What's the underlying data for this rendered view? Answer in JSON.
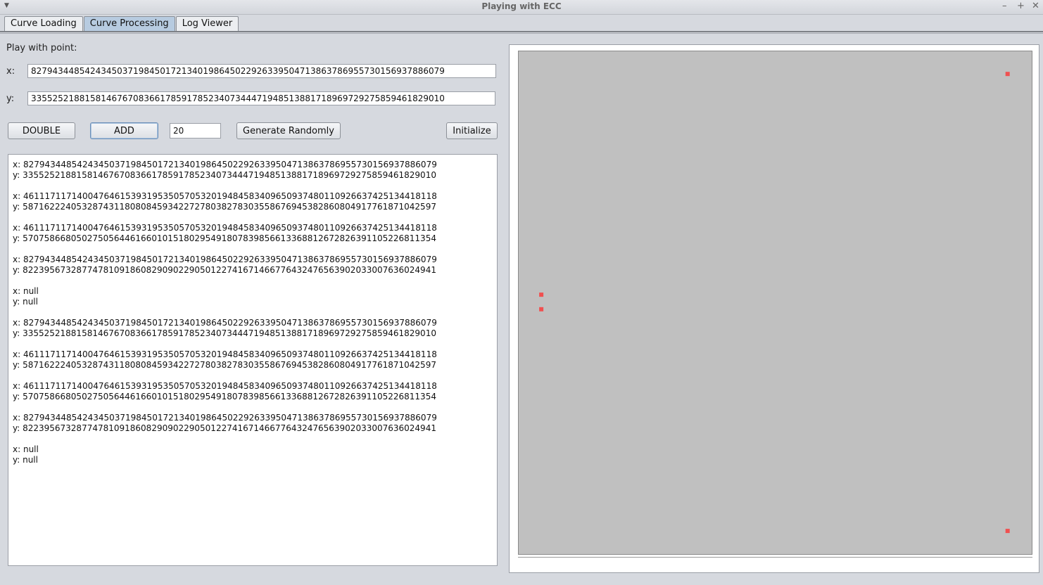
{
  "window": {
    "title": "Playing with ECC",
    "controls": [
      "–",
      "+",
      "✕"
    ]
  },
  "tabs": [
    {
      "label": "Curve Loading",
      "active": false
    },
    {
      "label": "Curve Processing",
      "active": true
    },
    {
      "label": "Log Viewer",
      "active": false
    }
  ],
  "point_panel": {
    "heading": "Play with point:",
    "x_label": "x:",
    "x_value": "82794344854243450371984501721340198645022926339504713863786955730156937886079",
    "y_label": "y:",
    "y_value": "33552521881581467670836617859178523407344471948513881718969729275859461829010"
  },
  "buttons": {
    "double": "DOUBLE",
    "add": "ADD",
    "count_value": "20",
    "generate": "Generate Randomly",
    "initialize": "Initialize"
  },
  "output_points": [
    {
      "x": "x: 82794344854243450371984501721340198645022926339504713863786955730156937886079",
      "y": "y: 33552521881581467670836617859178523407344471948513881718969729275859461829010"
    },
    {
      "x": "x: 46111711714004764615393195350570532019484583409650937480110926637425134418118",
      "y": "y: 58716222405328743118080845934227278038278303558676945382860804917761871042597"
    },
    {
      "x": "x: 46111711714004764615393195350570532019484583409650937480110926637425134418118",
      "y": "y: 57075866805027505644616601015180295491807839856613368812672826391105226811354"
    },
    {
      "x": "x: 82794344854243450371984501721340198645022926339504713863786955730156937886079",
      "y": "y: 82239567328774781091860829090229050122741671466776432476563902033007636024941"
    },
    {
      "x": "x: null",
      "y": "y: null"
    },
    {
      "x": "x: 82794344854243450371984501721340198645022926339504713863786955730156937886079",
      "y": "y: 33552521881581467670836617859178523407344471948513881718969729275859461829010"
    },
    {
      "x": "x: 46111711714004764615393195350570532019484583409650937480110926637425134418118",
      "y": "y: 58716222405328743118080845934227278038278303558676945382860804917761871042597"
    },
    {
      "x": "x: 46111711714004764615393195350570532019484583409650937480110926637425134418118",
      "y": "y: 57075866805027505644616601015180295491807839856613368812672826391105226811354"
    },
    {
      "x": "x: 82794344854243450371984501721340198645022926339504713863786955730156937886079",
      "y": "y: 82239567328774781091860829090229050122741671466776432476563902033007636024941"
    },
    {
      "x": "x: null",
      "y": "y: null"
    }
  ],
  "plot": {
    "background": "#c0c0c0",
    "point_color": "#f05050",
    "points": [
      {
        "fx": 0.953,
        "fy": 0.955
      },
      {
        "fx": 0.044,
        "fy": 0.516
      },
      {
        "fx": 0.044,
        "fy": 0.487
      },
      {
        "fx": 0.953,
        "fy": 0.046
      }
    ]
  }
}
